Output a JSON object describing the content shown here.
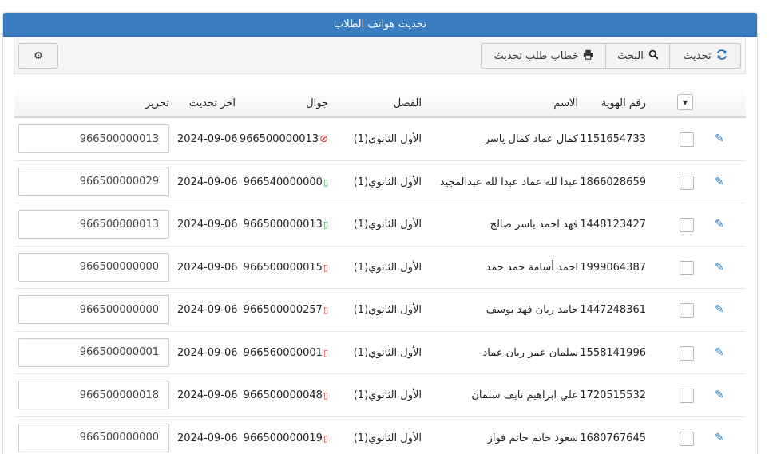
{
  "panel": {
    "title": "تحديث هواتف الطلاب"
  },
  "toolbar": {
    "refresh_label": "تحديث",
    "search_label": "البحث",
    "letter_label": "خطاب طلب تحديث"
  },
  "table": {
    "headers": {
      "id": "رقم الهوية",
      "name": "الاسم",
      "class": "الفصل",
      "mobile": "جوال",
      "last_update": "آخر تحديث",
      "edit": "تحرير"
    },
    "rows": [
      {
        "id": "1151654733",
        "name": "كمال عماد كمال ياسر",
        "class": "الأول الثانوي(1)",
        "mobile": "966500000013",
        "status": "blocked",
        "date": "2024-09-06",
        "edit_value": "966500000013"
      },
      {
        "id": "1866028659",
        "name": "عبدا لله عماد عبدا لله عبدالمجيد",
        "class": "الأول الثانوي(1)",
        "mobile": "966540000000",
        "status": "green",
        "date": "2024-09-06",
        "edit_value": "966500000029"
      },
      {
        "id": "1448123427",
        "name": "فهد احمد ياسر صالح",
        "class": "الأول الثانوي(1)",
        "mobile": "966500000013",
        "status": "green",
        "date": "2024-09-06",
        "edit_value": "966500000013"
      },
      {
        "id": "1999064387",
        "name": "احمد أسامة حمد حمد",
        "class": "الأول الثانوي(1)",
        "mobile": "966500000015",
        "status": "red",
        "date": "2024-09-06",
        "edit_value": "966500000000"
      },
      {
        "id": "1447248361",
        "name": "حامد ريان فهد يوسف",
        "class": "الأول الثانوي(1)",
        "mobile": "966500000257",
        "status": "red",
        "date": "2024-09-06",
        "edit_value": "966500000000"
      },
      {
        "id": "1558141996",
        "name": "سلمان عمر ريان عماد",
        "class": "الأول الثانوي(1)",
        "mobile": "966560000001",
        "status": "red",
        "date": "2024-09-06",
        "edit_value": "966500000001"
      },
      {
        "id": "1720515532",
        "name": "علي ابراهيم نايف سلمان",
        "class": "الأول الثانوي(1)",
        "mobile": "966500000048",
        "status": "red",
        "date": "2024-09-06",
        "edit_value": "966500000018"
      },
      {
        "id": "1680767645",
        "name": "سعود حاتم حاتم فواز",
        "class": "الأول الثانوي(1)",
        "mobile": "966500000019",
        "status": "red",
        "date": "2024-09-06",
        "edit_value": "966500000000"
      }
    ]
  },
  "colors": {
    "header_blue": "#3a7dc0",
    "icon_blue": "#2a7fc8",
    "status_green": "#1e9e3a",
    "status_red": "#d9251c"
  },
  "icons": {
    "refresh": "refresh-icon",
    "search": "search-icon",
    "print": "print-icon",
    "gear": "gear-icon",
    "edit": "edit-icon",
    "dropdown": "caret-down-icon"
  }
}
